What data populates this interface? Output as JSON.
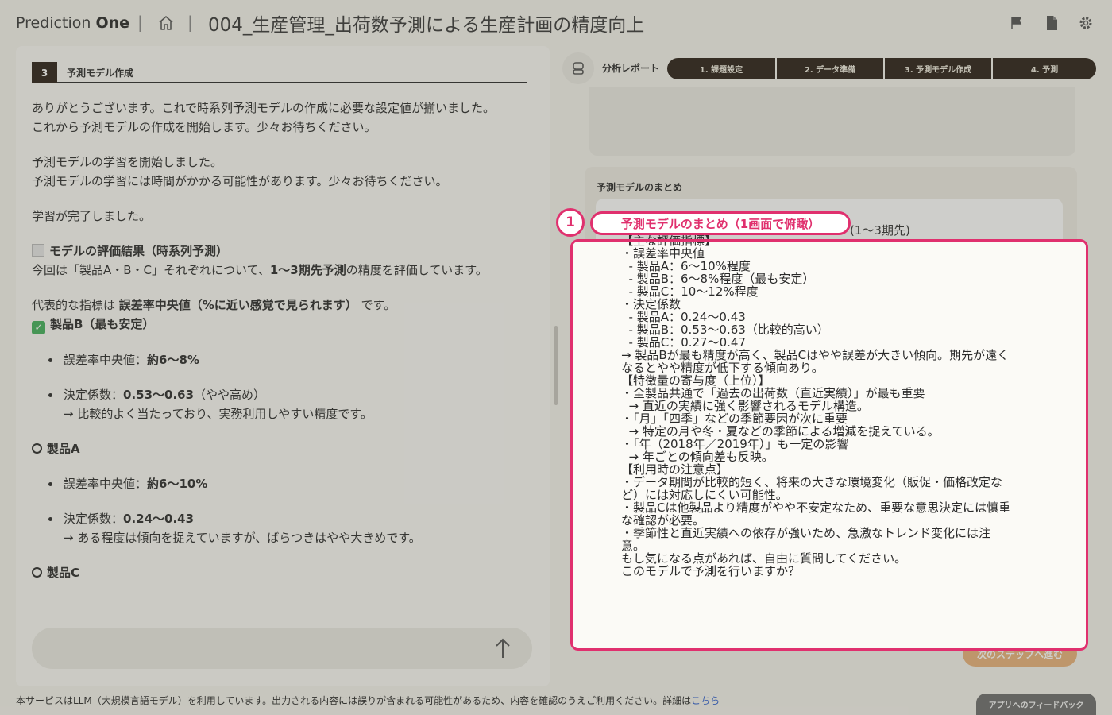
{
  "header": {
    "logo_light": "Prediction",
    "logo_bold": "One",
    "separator": "|",
    "title": "004_生産管理_出荷数予測による生産計画の精度向上",
    "icons": [
      "home-icon",
      "flag-icon",
      "document-icon",
      "gear-icon"
    ]
  },
  "step": {
    "number": "3",
    "label": "予測モデル作成"
  },
  "chat": {
    "lines": [
      "ありがとうございます。これで時系列予測モデルの作成に必要な設定値が揃いました。",
      "これから予測モデルの作成を開始します。少々お待ちください。",
      "予測モデルの学習を開始しました。",
      "予測モデルの学習には時間がかかる可能性があります。少々お待ちください。",
      "学習が完了しました。"
    ],
    "eval_heading": "モデルの評価結果（時系列予測）",
    "intro_pre": "今回は「製品A・B・C」それぞれについて、",
    "intro_bold": "1〜3期先予測",
    "intro_post": "の精度を評価しています。",
    "metric_pre": "代表的な指標は ",
    "metric_bold": "誤差率中央値（%に近い感覚で見られます）",
    "metric_post": " です。",
    "product_b": "製品B（最も安定）",
    "b_error_label": "誤差率中央値：",
    "b_error_value": "約6〜8%",
    "b_r2_label": "決定係数：",
    "b_r2_value": "0.53〜0.63",
    "b_r2_note": "（やや高め）",
    "b_comment": "→ 比較的よく当たっており、実務利用しやすい精度です。",
    "product_a": "製品A",
    "a_error_label": "誤差率中央値：",
    "a_error_value": "約6〜10%",
    "a_r2_label": "決定係数：",
    "a_r2_value": "0.24〜0.43",
    "a_comment": "→ ある程度は傾向を捉えていますが、ばらつきはやや大きめです。",
    "product_c": "製品C"
  },
  "report": {
    "label": "分析レポート",
    "tabs": [
      "1. 課題設定",
      "2. データ準備",
      "3. 予測モデル作成",
      "4. 予測"
    ]
  },
  "summary": {
    "title": "予測モデルのまとめ",
    "behind_text": "(1〜3期先)",
    "text": "【主な評価指標】\n・誤差率中央値\n  - 製品A：6〜10%程度\n  - 製品B：6〜8%程度（最も安定）\n  - 製品C：10〜12%程度\n・決定係数\n  - 製品A：0.24〜0.43\n  - 製品B：0.53〜0.63（比較的高い）\n  - 製品C：0.27〜0.47\n→ 製品Bが最も精度が高く、製品Cはやや誤差が大きい傾向。期先が遠く\nなるとやや精度が低下する傾向あり。\n【特徴量の寄与度（上位）】\n・全製品共通で「過去の出荷数（直近実績）」が最も重要\n  → 直近の実績に強く影響されるモデル構造。\n・「月」「四季」などの季節要因が次に重要\n  → 特定の月や冬・夏などの季節による増減を捉えている。\n・「年（2018年／2019年）」も一定の影響\n  → 年ごとの傾向差も反映。\n【利用時の注意点】\n・データ期間が比較的短く、将来の大きな環境変化（販促・価格改定な\nど）には対応しにくい可能性。\n・製品Cは他製品より精度がやや不安定なため、重要な意思決定には慎重\nな確認が必要。\n・季節性と直近実績への依存が強いため、急激なトレンド変化には注\n意。\nもし気になる点があれば、自由に質問してください。\nこのモデルで予測を行いますか？"
  },
  "highlight": {
    "number": "1",
    "label": "予測モデルのまとめ（1画面で俯瞰）",
    "color": "#e0306e"
  },
  "next_button": "次のステップへ進む",
  "footer": {
    "text": "本サービスはLLM（大規模言語モデル）を利用しています。出力される内容には誤りが含まれる可能性があるため、内容を確認のうえご利用ください。詳細は",
    "link": "こちら"
  },
  "feedback_button": "アプリへのフィードバック"
}
